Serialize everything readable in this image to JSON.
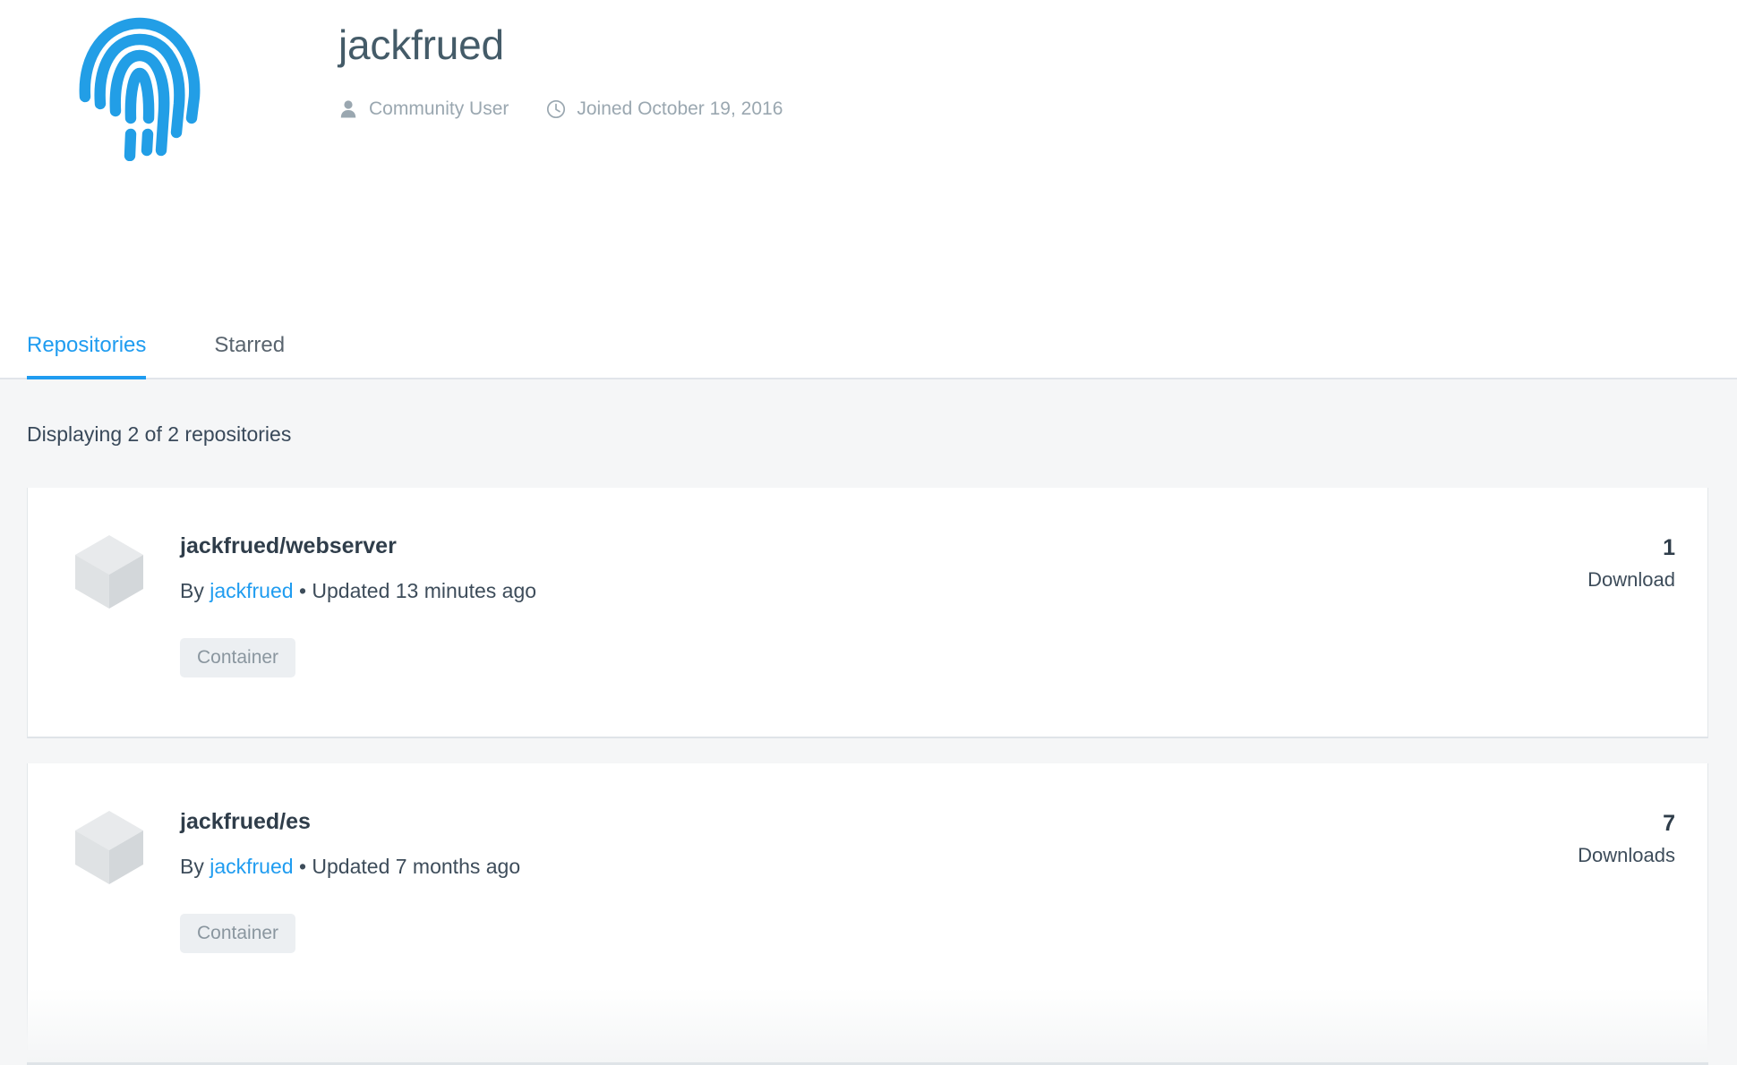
{
  "profile": {
    "username": "jackfrued",
    "avatar_icon": "fingerprint-icon",
    "avatar_color": "#229ee6",
    "meta": [
      {
        "icon": "person-icon",
        "label": "Community User"
      },
      {
        "icon": "clock-icon",
        "label": "Joined October 19, 2016"
      }
    ]
  },
  "tabs": [
    {
      "label": "Repositories",
      "active": true
    },
    {
      "label": "Starred",
      "active": false
    }
  ],
  "results": {
    "count_text": "Displaying 2 of 2 repositories"
  },
  "repositories": [
    {
      "icon": "cube-icon",
      "name": "jackfrued/webserver",
      "by_label": "By",
      "author": "jackfrued",
      "separator": "•",
      "updated": "Updated 13 minutes ago",
      "badges": [
        "Container"
      ],
      "stat_count": "1",
      "stat_label": "Download"
    },
    {
      "icon": "cube-icon",
      "name": "jackfrued/es",
      "by_label": "By",
      "author": "jackfrued",
      "separator": "•",
      "updated": "Updated 7 months ago",
      "badges": [
        "Container"
      ],
      "stat_count": "7",
      "stat_label": "Downloads"
    }
  ],
  "colors": {
    "accent": "#1f9cf0",
    "text_dark": "#2f3d4a",
    "text_muted": "#9aa7b0",
    "page_bg": "#f5f6f7",
    "card_bg": "#ffffff",
    "badge_bg": "#eceff2"
  }
}
